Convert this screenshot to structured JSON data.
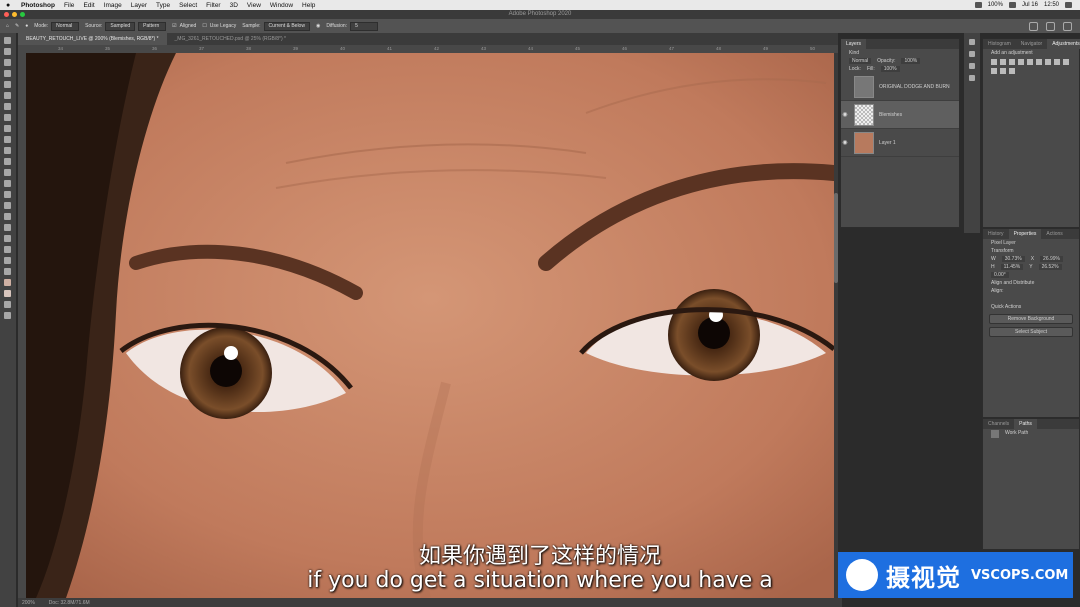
{
  "menubar": {
    "app": "Photoshop",
    "items": [
      "File",
      "Edit",
      "Image",
      "Layer",
      "Type",
      "Select",
      "Filter",
      "3D",
      "View",
      "Window",
      "Help"
    ],
    "battery": "100%",
    "date": "Jul 16",
    "time": "12:50"
  },
  "window": {
    "title": "Adobe Photoshop 2020"
  },
  "options": {
    "mode_label": "Mode:",
    "mode_value": "Normal",
    "source_label": "Source:",
    "source_value": "Sampled",
    "pattern_label": "Pattern",
    "aligned_label": "Aligned",
    "legacy_label": "Use Legacy",
    "sample_label": "Sample:",
    "sample_value": "Current & Below",
    "diffusion_label": "Diffusion:",
    "diffusion_value": "5"
  },
  "tabs": [
    {
      "label": "BEAUTY_RETOUCH_LIVE @ 200% (Blemishes, RGB/8*) *"
    },
    {
      "label": "_MG_3261_RETOUCHED.psd @ 25% (RGB/8*) *"
    }
  ],
  "ruler": [
    "34",
    "35",
    "36",
    "37",
    "38",
    "39",
    "40",
    "41",
    "42",
    "43",
    "44",
    "45",
    "46",
    "47",
    "48",
    "49",
    "50"
  ],
  "status": {
    "zoom": "200%",
    "doc": "Doc: 32.8M/71.6M"
  },
  "layers_panel": {
    "tab": "Layers",
    "kind_label": "Kind",
    "blend_mode": "Normal",
    "opacity_label": "Opacity:",
    "opacity_value": "100%",
    "lock_label": "Lock:",
    "fill_label": "Fill:",
    "fill_value": "100%",
    "layers": [
      {
        "name": "ORIGINAL DODGE AND BURN"
      },
      {
        "name": "Blemishes"
      },
      {
        "name": "Layer 1"
      }
    ]
  },
  "nav_panel": {
    "tabs": [
      "Histogram",
      "Navigator",
      "Adjustments"
    ],
    "add_label": "Add an adjustment"
  },
  "props_panel": {
    "tabs": [
      "History",
      "Properties",
      "Actions"
    ],
    "pixel_layer": "Pixel Layer",
    "transform_label": "Transform",
    "w_label": "W",
    "w_value": "30.73%",
    "x_label": "X",
    "x_value": "26.99%",
    "h_label": "H",
    "h_value": "11.45%",
    "y_label": "Y",
    "y_value": "26.52%",
    "angle_value": "0.00°",
    "align_label": "Align and Distribute",
    "align_sub": "Align:",
    "quick_label": "Quick Actions",
    "remove_bg": "Remove Background",
    "select_subject": "Select Subject"
  },
  "channels_panel": {
    "tabs": [
      "Channels",
      "Paths"
    ],
    "path_name": "Work Path"
  },
  "subtitles": {
    "cn": "如果你遇到了这样的情况",
    "en": "if you do get a situation where you have a"
  },
  "watermark": {
    "cn": "摄视觉",
    "en": "VSCOPS.COM"
  },
  "colors": {
    "accent": "#1e6fe0",
    "skin": "#c78765"
  }
}
